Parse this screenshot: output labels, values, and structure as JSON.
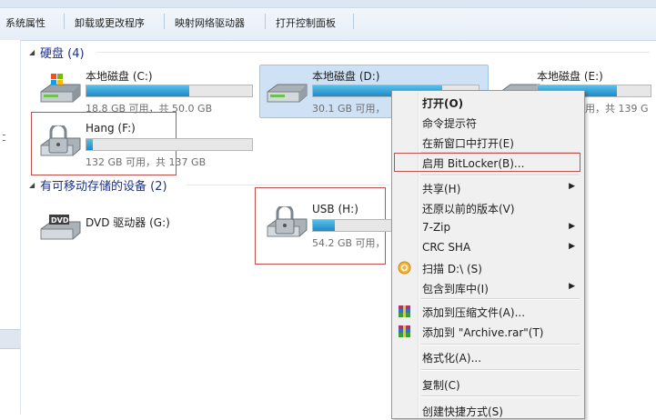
{
  "toolbar": {
    "items": [
      "系统属性",
      "卸载或更改程序",
      "映射网络驱动器",
      "打开控制面板"
    ]
  },
  "sections": {
    "hard_disks": "硬盘 (4)",
    "removable": "有可移动存储的设备 (2)"
  },
  "drives": [
    {
      "label": "本地磁盘 (C:)",
      "free": "18.8 GB 可用，共 50.0 GB",
      "used": 0.62
    },
    {
      "label": "本地磁盘 (D:)",
      "free": "30.1 GB 可用，",
      "used": 0.78
    },
    {
      "label": "本地磁盘 (E:)",
      "free": "可用，共 139 G",
      "used": 0.7
    },
    {
      "label": "Hang (F:)",
      "free": "132 GB 可用，共 137 GB",
      "used": 0.04
    },
    {
      "label": "DVD 驱动器 (G:)",
      "free": "",
      "used": 0
    },
    {
      "label": "USB (H:)",
      "free": "54.2 GB 可用，",
      "used": 0.25
    }
  ],
  "context_menu": [
    {
      "label": "打开(O)",
      "bold": true
    },
    {
      "label": "命令提示符"
    },
    {
      "label": "在新窗口中打开(E)"
    },
    {
      "label": "启用 BitLocker(B)..."
    },
    {
      "label": "共享(H)",
      "submenu": true
    },
    {
      "label": "还原以前的版本(V)"
    },
    {
      "label": "7-Zip",
      "submenu": true
    },
    {
      "label": "CRC SHA",
      "submenu": true
    },
    {
      "label": "扫描 D:\\ (S)",
      "icon": "scan-icon"
    },
    {
      "label": "包含到库中(I)",
      "submenu": true
    },
    {
      "label": "添加到压缩文件(A)...",
      "icon": "winrar-icon"
    },
    {
      "label": "添加到 \"Archive.rar\"(T)",
      "icon": "winrar-icon"
    },
    {
      "label": "格式化(A)..."
    },
    {
      "label": "复制(C)"
    },
    {
      "label": "创建快捷方式(S)"
    }
  ],
  "colors": {
    "accent_text": "#1e3287",
    "bar_fill": "#1f89c8",
    "highlight_box": "#c0504d",
    "selection": "#cfe2f5"
  }
}
